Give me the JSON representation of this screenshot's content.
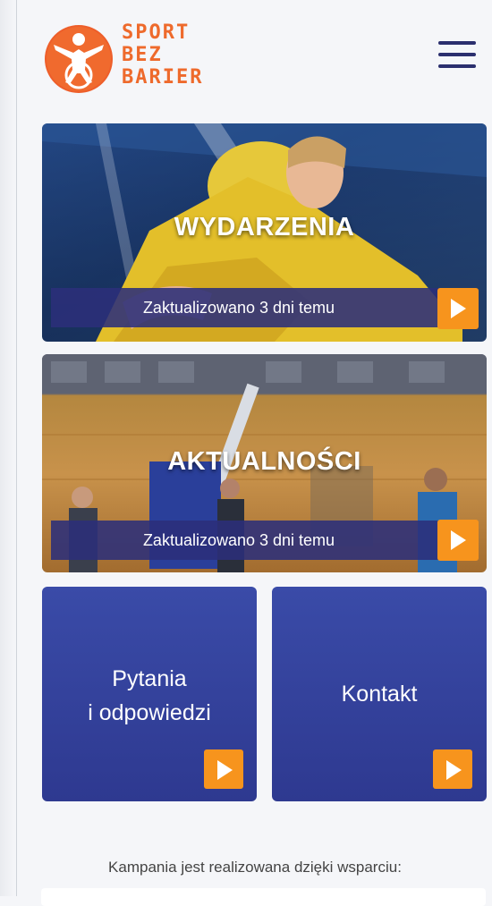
{
  "logo": {
    "line1": "SPORT",
    "line2": "BEZ",
    "line3": "BARIER"
  },
  "menu_icon": "hamburger-menu-icon",
  "cards": [
    {
      "title": "WYDARZENIA",
      "status": "Zaktualizowano 3 dni temu",
      "button_icon": "play-icon"
    },
    {
      "title": "AKTUALNOŚCI",
      "status": "Zaktualizowano 3 dni temu",
      "button_icon": "play-icon"
    }
  ],
  "tiles": [
    {
      "line1": "Pytania",
      "line2": "i odpowiedzi",
      "button_icon": "play-icon"
    },
    {
      "label": "Kontakt",
      "button_icon": "play-icon"
    }
  ],
  "footer": {
    "text": "Kampania jest realizowana dzięki wsparciu:"
  },
  "colors": {
    "brand_orange": "#ee6a2c",
    "button_orange": "#f7941d",
    "navy": "#2b2f7a",
    "tile_blue": "#34439c"
  }
}
